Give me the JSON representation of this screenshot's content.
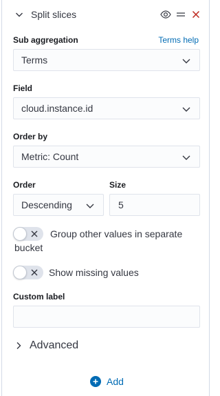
{
  "header": {
    "title": "Split slices"
  },
  "sub_aggregation": {
    "label": "Sub aggregation",
    "help_link": "Terms help",
    "value": "Terms"
  },
  "field": {
    "label": "Field",
    "value": "cloud.instance.id"
  },
  "order_by": {
    "label": "Order by",
    "value": "Metric: Count"
  },
  "order": {
    "label": "Order",
    "value": "Descending"
  },
  "size": {
    "label": "Size",
    "value": "5"
  },
  "toggles": {
    "group_other": {
      "label": "Group other values in separate bucket",
      "on": false
    },
    "show_missing": {
      "label": "Show missing values",
      "on": false
    }
  },
  "custom_label": {
    "label": "Custom label",
    "value": ""
  },
  "advanced": {
    "label": "Advanced"
  },
  "add": {
    "label": "Add"
  },
  "colors": {
    "link": "#006bb4",
    "danger": "#bd271e",
    "border": "#dfe3eb",
    "text": "#343741"
  }
}
